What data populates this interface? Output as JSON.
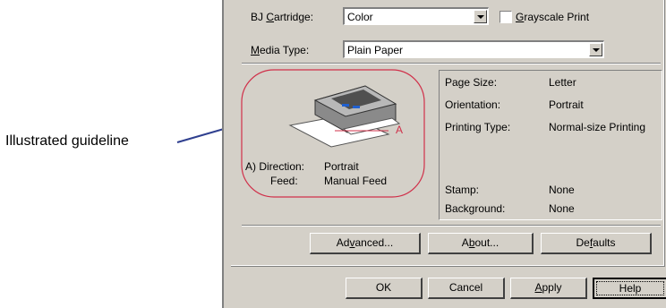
{
  "callout": {
    "text": "Illustrated guideline"
  },
  "cartridge": {
    "label_prefix": "BJ ",
    "label_u": "C",
    "label_rest": "artridge:",
    "value": "Color"
  },
  "grayscale": {
    "label_u": "G",
    "label_rest": "rayscale Print",
    "checked": false
  },
  "media": {
    "label_u": "M",
    "label_rest": "edia Type:",
    "value": "Plain Paper"
  },
  "illustration": {
    "marker": "A",
    "direction_label": "A) Direction:",
    "direction_value": "Portrait",
    "feed_label": "Feed:",
    "feed_value": "Manual Feed"
  },
  "info": {
    "page_size_label": "Page Size:",
    "page_size_value": "Letter",
    "orientation_label": "Orientation:",
    "orientation_value": "Portrait",
    "printing_type_label": "Printing Type:",
    "printing_type_value": "Normal-size Printing",
    "stamp_label": "Stamp:",
    "stamp_value": "None",
    "background_label": "Background:",
    "background_value": "None"
  },
  "buttons": {
    "advanced_pre": "Ad",
    "advanced_u": "v",
    "advanced_post": "anced...",
    "about_pre": "A",
    "about_u": "b",
    "about_post": "out...",
    "defaults_pre": "De",
    "defaults_u": "f",
    "defaults_post": "aults",
    "ok": "OK",
    "cancel": "Cancel",
    "apply_u": "A",
    "apply_post": "pply",
    "help": "Help"
  },
  "colors": {
    "callout_line": "#2f3f8f",
    "illustration_border": "#d0304a",
    "dialog_bg": "#d4d0c8"
  }
}
